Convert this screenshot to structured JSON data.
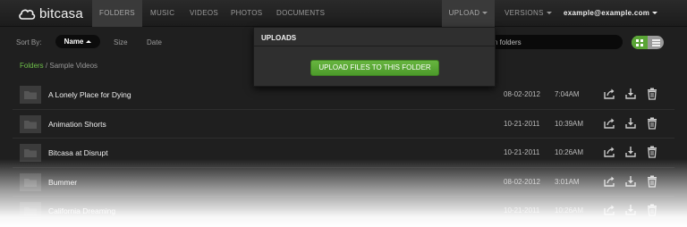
{
  "brand": {
    "name": "bitcasa"
  },
  "nav": {
    "items": [
      {
        "label": "FOLDERS"
      },
      {
        "label": "MUSIC"
      },
      {
        "label": "VIDEOS"
      },
      {
        "label": "PHOTOS"
      },
      {
        "label": "DOCUMENTS"
      }
    ],
    "upload_label": "UPLOAD",
    "versions_label": "VERSIONS",
    "account_label": "example@example.com"
  },
  "toolbar": {
    "sort_label": "Sort By:",
    "sort_selected": "Name",
    "sort_options": [
      "Size",
      "Date"
    ],
    "search_placeholder": "n folders"
  },
  "breadcrumb": {
    "root": "Folders",
    "separator": "/",
    "current": "Sample Videos"
  },
  "uploads_menu": {
    "title": "UPLOADS",
    "button_label": "UPLOAD FILES TO THIS FOLDER"
  },
  "files": [
    {
      "name": "A Lonely Place for Dying",
      "date": "08-02-2012",
      "time": "7:04AM"
    },
    {
      "name": "Animation Shorts",
      "date": "10-21-2011",
      "time": "10:39AM"
    },
    {
      "name": "Bitcasa at Disrupt",
      "date": "10-21-2011",
      "time": "10:26AM"
    },
    {
      "name": "Bummer",
      "date": "08-02-2012",
      "time": "3:01AM"
    },
    {
      "name": "California Dreaming",
      "date": "10-21-2011",
      "time": "10:26AM"
    }
  ],
  "colors": {
    "accent_green": "#5aa536",
    "background": "#1f1f1f",
    "nav_active": "#3a3a3a"
  },
  "icons": [
    "cloud-logo-icon",
    "folder-icon",
    "share-icon",
    "download-icon",
    "trash-icon",
    "grid-view-icon",
    "list-view-icon"
  ]
}
